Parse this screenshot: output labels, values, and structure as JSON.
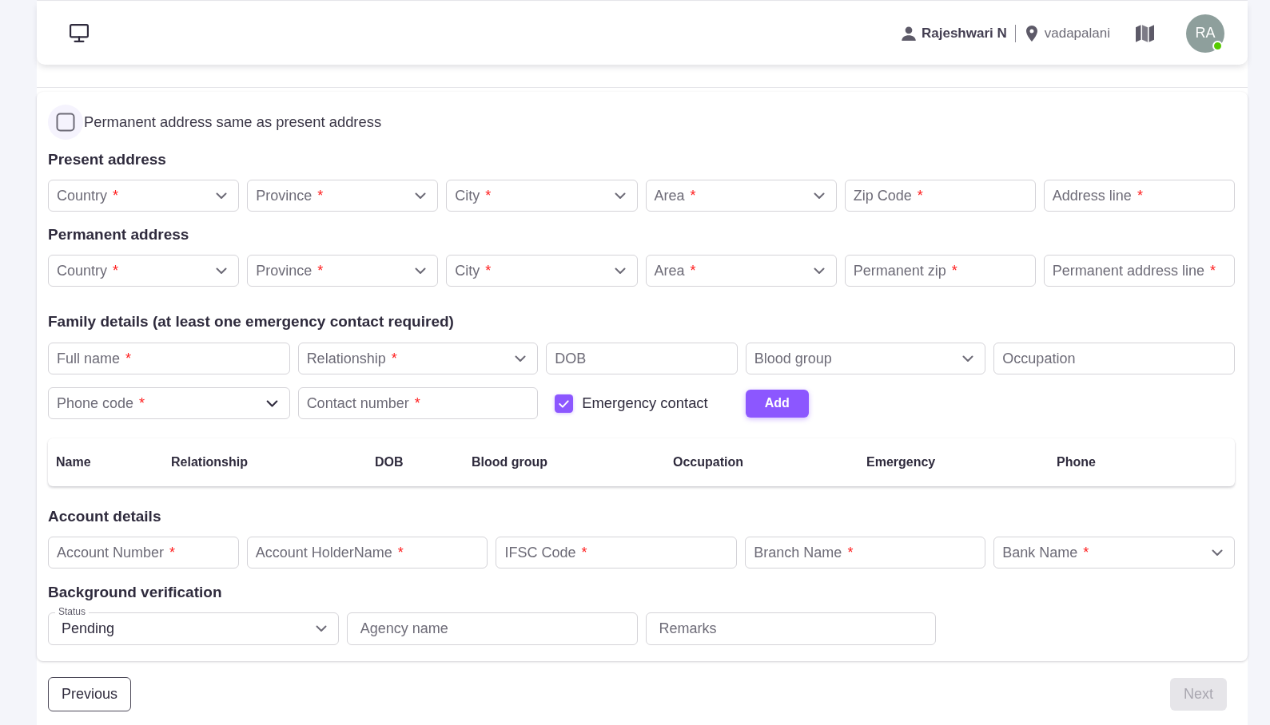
{
  "header": {
    "user_name": "Rajeshwari N",
    "location": "vadapalani",
    "avatar": {
      "initials": "RA",
      "online": true
    }
  },
  "form": {
    "same_address": {
      "label": "Permanent address same as present address",
      "checked": false
    },
    "present_address": {
      "title": "Present address",
      "fields": [
        {
          "kind": "select",
          "label": "Country",
          "required_mark": "*"
        },
        {
          "kind": "select",
          "label": "Province",
          "required_mark": "*"
        },
        {
          "kind": "select",
          "label": "City",
          "required_mark": "*"
        },
        {
          "kind": "select",
          "label": "Area",
          "required_mark": "*"
        },
        {
          "kind": "input",
          "label": "Zip Code",
          "required_mark": "*"
        },
        {
          "kind": "input",
          "label": "Address line",
          "required_mark": "*"
        }
      ]
    },
    "permanent_address": {
      "title": "Permanent address",
      "fields": [
        {
          "kind": "select",
          "label": "Country",
          "required_mark": "*"
        },
        {
          "kind": "select",
          "label": "Province",
          "required_mark": "*"
        },
        {
          "kind": "select",
          "label": "City",
          "required_mark": "*"
        },
        {
          "kind": "select",
          "label": "Area",
          "required_mark": "*"
        },
        {
          "kind": "input",
          "label": "Permanent zip",
          "required_mark": "*"
        },
        {
          "kind": "input",
          "label": "Permanent address line",
          "required_mark": "*"
        }
      ]
    },
    "family_details": {
      "title": "Family details (at least one emergency contact required)",
      "fields": [
        {
          "kind": "input",
          "label": "Full name",
          "required_mark": "*"
        },
        {
          "kind": "select",
          "label": "Relationship",
          "required_mark": "*"
        },
        {
          "kind": "input",
          "label": "DOB"
        },
        {
          "kind": "select",
          "label": "Blood group"
        },
        {
          "kind": "input",
          "label": "Occupation"
        },
        {
          "kind": "autocomplete",
          "label": "Phone code",
          "required_mark": "*"
        },
        {
          "kind": "input",
          "label": "Contact number",
          "required_mark": "*"
        },
        {
          "kind": "checkbox",
          "label": "Emergency contact",
          "checked": true
        },
        {
          "kind": "button",
          "label": "Add"
        }
      ],
      "table": {
        "columns": [
          "Name",
          "Relationship",
          "DOB",
          "Blood group",
          "Occupation",
          "Emergency",
          "Phone"
        ]
      }
    },
    "account_details": {
      "title": "Account details",
      "fields": [
        {
          "kind": "input",
          "label": "Account Number",
          "required_mark": "*"
        },
        {
          "kind": "input",
          "label": "Account HolderName",
          "required_mark": "*"
        },
        {
          "kind": "input",
          "label": "IFSC Code",
          "required_mark": "*"
        },
        {
          "kind": "input",
          "label": "Branch Name",
          "required_mark": "*"
        },
        {
          "kind": "select",
          "label": "Bank Name",
          "required_mark": "*"
        }
      ]
    },
    "background_verification": {
      "title": "Background verification",
      "fields": [
        {
          "kind": "select",
          "label": "Status",
          "value": "Pending"
        },
        {
          "kind": "input",
          "label": "Agency name"
        },
        {
          "kind": "input",
          "label": "Remarks"
        }
      ]
    }
  },
  "footer": {
    "buttons": [
      {
        "kind": "outlined",
        "label": "Previous",
        "disabled": false
      },
      {
        "kind": "contained",
        "label": "Next",
        "disabled": true
      }
    ]
  }
}
